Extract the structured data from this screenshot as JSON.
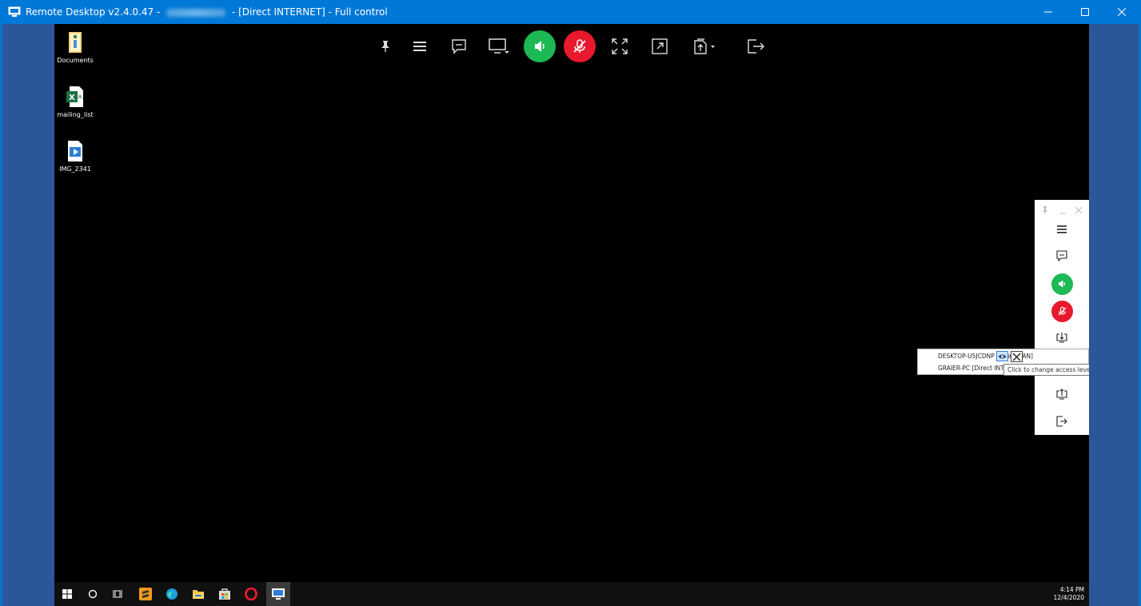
{
  "window": {
    "title_prefix": "Remote Desktop v2.4.0.47 - ",
    "title_suffix": " - [Direct INTERNET] - Full control",
    "accent_color": "#0078d7"
  },
  "toolbar": {
    "items": [
      "pin-icon",
      "menu-icon",
      "chat-icon",
      "monitor-icon",
      "speaker-on-icon",
      "mic-off-icon",
      "fullscreen-icon",
      "open-window-icon",
      "file-transfer-icon",
      "disconnect-icon"
    ],
    "green": "#1db954",
    "red": "#e8192c"
  },
  "desktop": {
    "icons": [
      {
        "label": "Documents",
        "icon": "folder-icon"
      },
      {
        "label": "mailing_list",
        "icon": "excel-icon"
      },
      {
        "label": "IMG_2341",
        "icon": "video-file-icon"
      }
    ]
  },
  "panel": {
    "items": [
      "menu-icon",
      "chat-icon",
      "speaker-on-icon",
      "mic-off-icon",
      "share-screen-icon",
      "share-screen-icon",
      "disconnect-icon"
    ]
  },
  "popup": {
    "rows": [
      "DESKTOP-U5JCDNP [Direct LAN]",
      "GRAIER-PC [Direct INTE"
    ],
    "tooltip": "Click to change access level"
  },
  "taskbar": {
    "time": "4:14 PM",
    "date": "12/4/2020"
  }
}
